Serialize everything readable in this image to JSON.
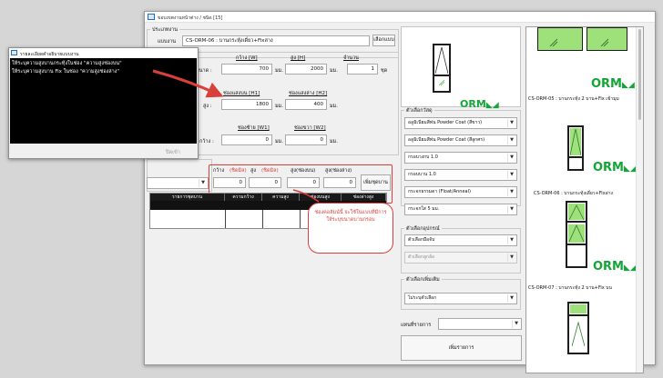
{
  "main_window": {
    "title": "ขอบเขตงานหน้าต่าง / ชนิด [15]",
    "section_work": "ประเภทงาน",
    "pattern_label": "แบบงาน",
    "pattern_value": "CS-ORM-06 : บานกระทุ้งเดี่ยว+Fixล่าง",
    "select_button": "เลือกแบบ",
    "dims": {
      "width_label": "กว้าง [W]",
      "height_label": "สูง [H]",
      "qty_label": "จำนวน",
      "size_label": "ขนาด :",
      "width_value": "700",
      "height_value": "2000",
      "qty_value": "1",
      "mm": "มม.",
      "set": "ชุด",
      "top_panel_label": "ช่องแสงบน [H1]",
      "bottom_panel_label": "ช่องแสงล่าง [H2]",
      "height_colon": "สูง :",
      "h1_value": "1800",
      "h2_value": "400",
      "left_panel_label": "ช่องซ้าย [W1]",
      "right_panel_label": "ช่องขวา [W2]",
      "width_colon": "กว้าง :",
      "w1_value": "0",
      "w2_value": "0"
    },
    "set_row": {
      "headers": [
        "กว้าง",
        "(ชิดมิล)",
        "สูง",
        "(ชิดมิล)",
        "สูง(ช่องบน)",
        "สูง(ช่องล่าง)"
      ],
      "values": [
        "0",
        "0",
        "0",
        "0"
      ],
      "add_button": "เพิ่มชุดบาน"
    },
    "table_headers": [
      "รายการชุดบาน",
      "ความกว้าง",
      "ความสูง",
      "ช่องบนสูง",
      "ช่องล่างสูง"
    ],
    "materials": {
      "legend": "ตัวเลือกวัสดุ",
      "options": [
        "อลูมิเนียมสีพ่น Powder Coat (สีขาว)",
        "อลูมิเนียมสีพ่น Powder Coat (สีลูกศร)",
        "กรอบวงกบ 1.0",
        "กรอบบาน 1.0",
        "กระจกธรรมดา (Float/Anneal)",
        "กระจกใส 5 มม."
      ]
    },
    "accessories": {
      "legend": "ตัวเลือกอุปกรณ์",
      "options": [
        "ตัวเลือกมือจับ",
        "ตัวเลือกลูกล้อ"
      ]
    },
    "extras": {
      "legend": "ตัวเลือกเพิ่มเติม",
      "options": [
        "ไม่ระบุตัวเลือก"
      ]
    },
    "item_label": "แทนที่รายการ",
    "add_item_button": "เพิ่มรายการ",
    "preview_brand": "ORM",
    "catalog": {
      "brand": "ORM",
      "items": [
        "CS-ORM-05 : บานกระทุ้ง 2 บาน+Fix เข้ามุม",
        "CS-ORM-06 : บานกระทุ้งเดี่ยว+Fixล่าง",
        "CS-ORM-07 : บานกระทุ้ง 2 บาน+Fix บน"
      ]
    }
  },
  "side_window": {
    "title": "รายละเอียดคำอธิบายแบบงาน",
    "lines": [
      "ให้ระบุความสูงบานกระทุ้งในช่อง \"ความสูงช่องบน\"",
      "ให้ระบุความสูงบาน Fix ในช่อง \"ความสูงช่องล่าง\""
    ],
    "close_button": "ปิดเข้า"
  },
  "callout": {
    "text": "ช่องคอลัมน์นี้ จะใช้ในแบบที่มีการให้ระบุขนาดบานกรอบ",
    "color": "#d9403a"
  },
  "colors": {
    "annotation_red": "#d9403a",
    "brand_green": "#13a535",
    "highlight_green": "#9ee07a"
  }
}
